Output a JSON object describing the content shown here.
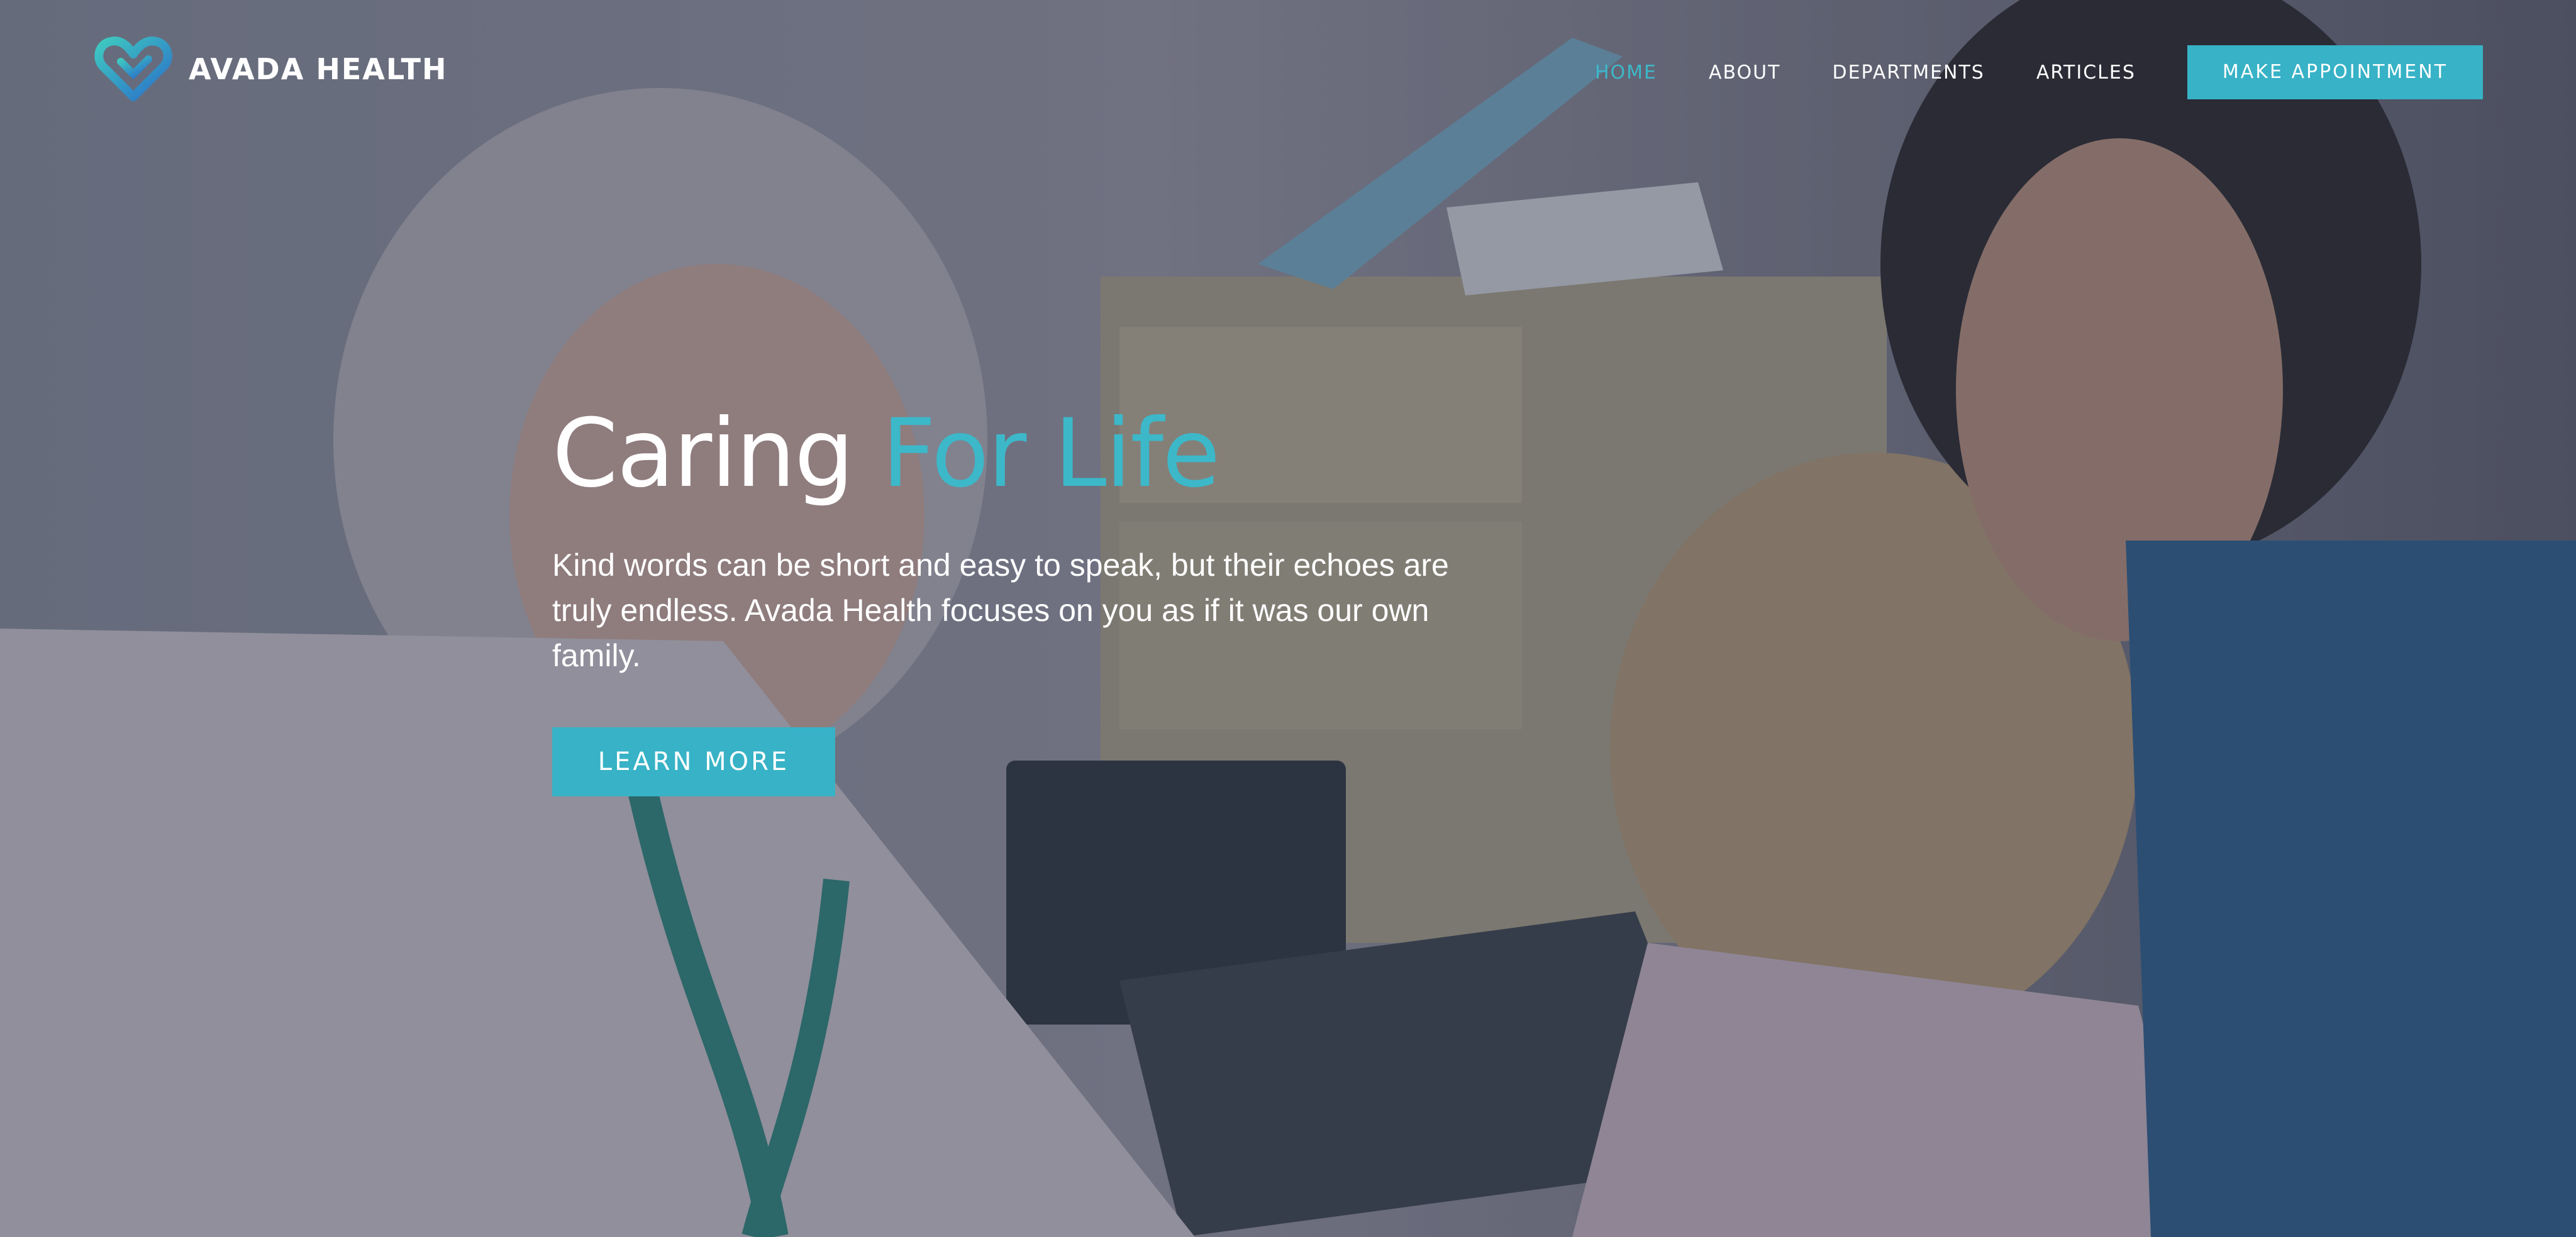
{
  "brand": {
    "name": "AVADA HEALTH",
    "logo_icon": "heart-logo-icon",
    "accent_color": "#37b2c6"
  },
  "nav": {
    "items": [
      {
        "label": "HOME",
        "active": true
      },
      {
        "label": "ABOUT",
        "active": false
      },
      {
        "label": "DEPARTMENTS",
        "active": false
      },
      {
        "label": "ARTICLES",
        "active": false
      }
    ],
    "cta_label": "MAKE APPOINTMENT"
  },
  "hero": {
    "headline_main": "Caring",
    "headline_accent": "For Life",
    "lead": "Kind words can be short and easy to speak, but their echoes are truly endless. Avada Health focuses on you as if it was our own family.",
    "button_label": "LEARN MORE",
    "background": "photo of a doctor examining a young girl with her mother"
  }
}
